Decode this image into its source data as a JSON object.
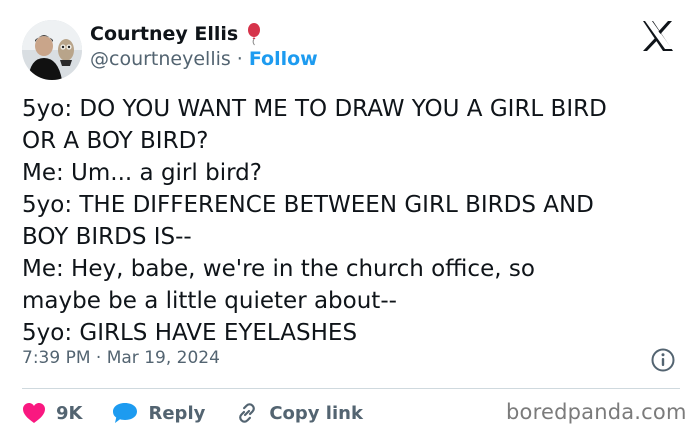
{
  "author": {
    "name": "Courtney Ellis",
    "handle": "@courtneyellis",
    "separator": "·",
    "follow_label": "Follow",
    "name_badge_icon": "balloon-icon"
  },
  "tweet": {
    "lines": [
      "5yo: DO YOU WANT ME TO DRAW YOU A GIRL BIRD",
      "OR A BOY BIRD?",
      "Me: Um... a girl bird?",
      "5yo: THE DIFFERENCE BETWEEN GIRL BIRDS AND",
      "BOY BIRDS IS--",
      "Me: Hey, babe, we're in the church office, so",
      "maybe be a little quieter about--",
      "5yo: GIRLS HAVE EYELASHES"
    ],
    "timestamp": "7:39 PM · Mar 19, 2024"
  },
  "actions": {
    "likes_count": "9K",
    "reply_label": "Reply",
    "copy_link_label": "Copy link"
  },
  "watermark": "boredpanda.com",
  "colors": {
    "like": "#f91880",
    "reply": "#1d9bf0",
    "follow": "#1d9bf0",
    "muted": "#536471",
    "badge": "#d6334a"
  }
}
